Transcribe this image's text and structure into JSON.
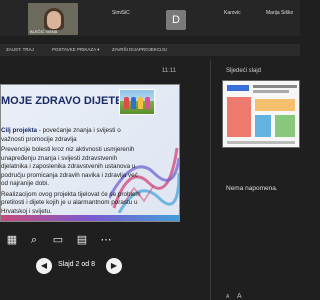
{
  "participants": [
    {
      "name": "BLEČIĆ IVANA"
    },
    {
      "name": "ŠimiŠiĆ"
    },
    {
      "name": "Karovic"
    },
    {
      "name": "Marija Šiško"
    }
  ],
  "avatar_initial": "D",
  "controls": {
    "stop_share": "ZAUST. TRAJ",
    "present_label": "POSTAVKE PRIKAZA ▾",
    "end_label": "ZAVRŠI DIJAPROJEKCIJU"
  },
  "slide": {
    "time": "11:11",
    "title": "MOJE ZDRAVO DIJETE",
    "goal_label": "Cilj projekta",
    "goal_text": "- povećanje znanja i svijesti o važnosti promocije zdravlja",
    "bullets": [
      "Prevencije bolesti kroz niz aktivnosti usmjerenih unapređenju znanja i svijesti zdravstvenih djelatnika i zaposlenika zdravstvenih ustanova u području promicanja zdravih navika i zdravlja već od najranije dobi.",
      "Realizacijom ovog projekta tijelovat će se problem pretilosti i dijete kojih je u alarmantnom porastu u Hrvatskoj i svijetu."
    ]
  },
  "pager": {
    "text": "Slajd 2 od 8"
  },
  "right": {
    "next_label": "Sljedeći slajd",
    "notes": "Nema napomena.",
    "font_small": "A",
    "font_large": "A"
  }
}
